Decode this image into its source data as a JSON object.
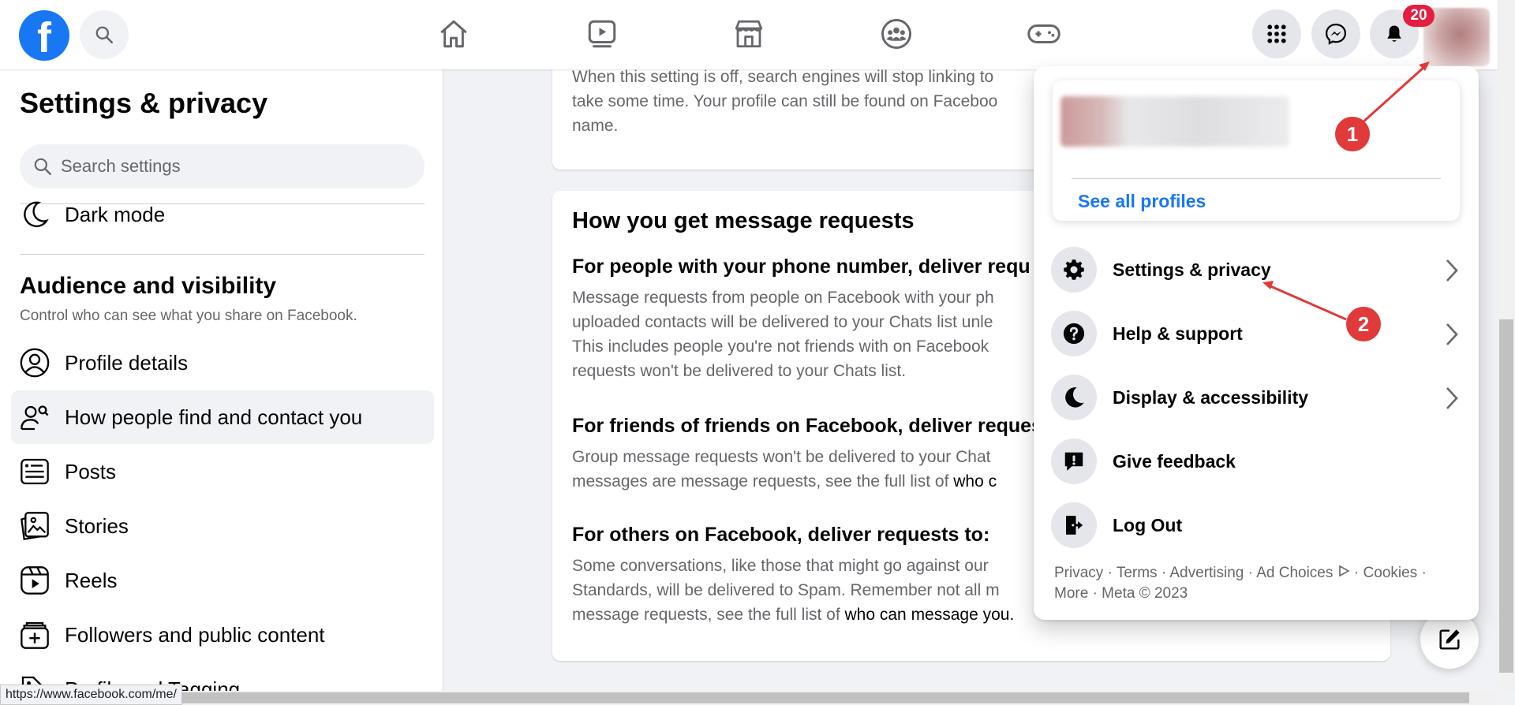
{
  "topbar": {
    "logo_letter": "f",
    "notifications_badge": "20",
    "nav_icons": [
      "home-icon",
      "watch-icon",
      "marketplace-icon",
      "groups-icon",
      "gaming-icon"
    ]
  },
  "sidebar": {
    "title": "Settings & privacy",
    "search_placeholder": "Search settings",
    "dark_mode_label": "Dark mode",
    "section_title": "Audience and visibility",
    "section_subtitle": "Control who can see what you share on Facebook.",
    "items": [
      {
        "label": "Profile details",
        "icon": "profile-icon"
      },
      {
        "label": "How people find and contact you",
        "icon": "people-search-icon",
        "active": true
      },
      {
        "label": "Posts",
        "icon": "posts-icon"
      },
      {
        "label": "Stories",
        "icon": "stories-icon"
      },
      {
        "label": "Reels",
        "icon": "reels-icon"
      },
      {
        "label": "Followers and public content",
        "icon": "followers-icon"
      },
      {
        "label": "Profile and Tagging",
        "icon": "tagging-icon"
      }
    ]
  },
  "main": {
    "card1_text_1": "When this setting is off, search engines will stop linking to",
    "card1_text_2": "take some time. Your profile can still be found on Faceboo",
    "card1_text_3": "name.",
    "card2_title": "How you get message requests",
    "phone_heading": "For people with your phone number, deliver requ",
    "phone_text_1": "Message requests from people on Facebook with your ph",
    "phone_text_2": "uploaded contacts will be delivered to your Chats list unle",
    "phone_text_3": "This includes people you're not friends with on Facebook",
    "phone_text_4": "requests won't be delivered to your Chats list.",
    "fof_heading": "For friends of friends on Facebook, deliver reques",
    "fof_text_1": "Group message requests won't be delivered to your Chat",
    "fof_text_2a": "messages are message requests, see the full list of ",
    "fof_text_2b": "who c",
    "others_heading": "For others on Facebook, deliver requests to:",
    "others_text_1": "Some conversations, like those that might go against our",
    "others_text_2": "Standards, will be delivered to Spam. Remember not all m",
    "others_text_3a": "message requests, see the full list of ",
    "others_text_3b": "who can message you."
  },
  "dropdown": {
    "see_all_profiles": "See all profiles",
    "menu": [
      {
        "label": "Settings & privacy",
        "icon": "gear-icon",
        "chevron": true
      },
      {
        "label": "Help & support",
        "icon": "help-icon",
        "chevron": true
      },
      {
        "label": "Display & accessibility",
        "icon": "moon-icon",
        "chevron": true
      },
      {
        "label": "Give feedback",
        "icon": "feedback-icon",
        "chevron": false
      },
      {
        "label": "Log Out",
        "icon": "logout-icon",
        "chevron": false
      }
    ],
    "legal_line_1": "Privacy · Terms · Advertising · Ad Choices ",
    "legal_line_1b": " · Cookies ·",
    "legal_line_2": "More · Meta © 2023"
  },
  "annotations": [
    "1",
    "2"
  ],
  "status_url": "https://www.facebook.com/me/",
  "colors": {
    "brand": "#1877f2",
    "badge": "#e41e3f",
    "annotation": "#e03a3a"
  }
}
